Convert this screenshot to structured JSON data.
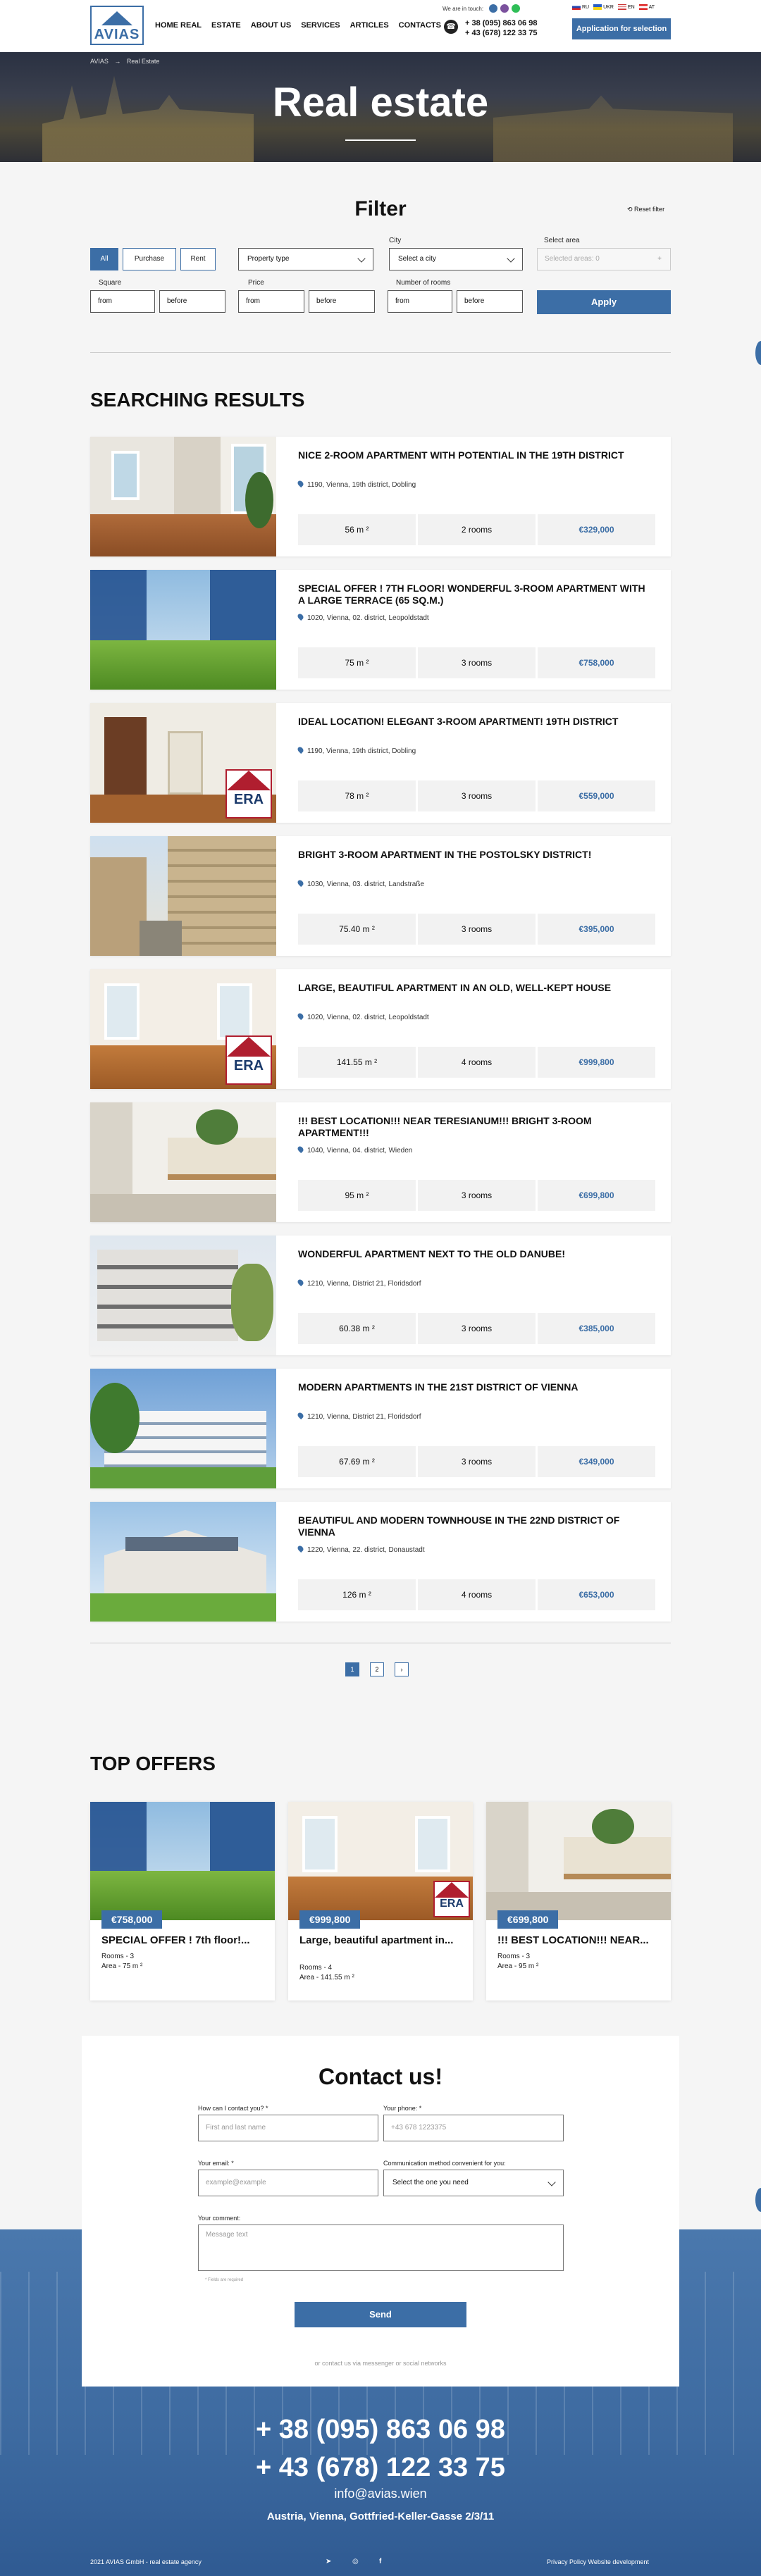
{
  "header": {
    "logo": "AVIAS",
    "nav": [
      "HOME REAL",
      "ESTATE",
      "ABOUT US",
      "SERVICES",
      "ARTICLES",
      "CONTACTS"
    ],
    "touch_label": "We are in touch:",
    "phone1": "+ 38 (095) 863 06 98",
    "phone2": "+ 43 (678) 122 33 75",
    "langs": [
      "RU",
      "UKR",
      "EN",
      "AT"
    ],
    "apply_button": "Application for selection"
  },
  "hero": {
    "breadcrumb_home": "AVIAS",
    "breadcrumb_sep": "→",
    "breadcrumb_current": "Real Estate",
    "title": "Real estate"
  },
  "filter": {
    "title": "Filter",
    "reset": "Reset filter",
    "types": [
      "All",
      "Purchase",
      "Rent"
    ],
    "property_type": "Property type",
    "city_label": "City",
    "city_placeholder": "Select a city",
    "area_label": "Select area",
    "area_placeholder": "Selected areas: 0",
    "square_label": "Square",
    "price_label": "Price",
    "rooms_label": "Number of rooms",
    "from": "from",
    "before": "before",
    "apply": "Apply"
  },
  "results": {
    "title": "SEARCHING RESULTS",
    "items": [
      {
        "title": "NICE 2-ROOM APARTMENT WITH POTENTIAL IN THE 19TH DISTRICT",
        "address": "1190, Vienna, 19th district, Dobling",
        "area": "56 m ²",
        "rooms": "2 rooms",
        "price": "€329,000"
      },
      {
        "title": "SPECIAL OFFER ! 7TH FLOOR! WONDERFUL 3-ROOM APARTMENT WITH A LARGE TERRACE (65 SQ.M.)",
        "address": "1020, Vienna, 02. district, Leopoldstadt",
        "area": "75 m ²",
        "rooms": "3 rooms",
        "price": "€758,000"
      },
      {
        "title": "IDEAL LOCATION! ELEGANT 3-ROOM APARTMENT! 19TH DISTRICT",
        "address": "1190, Vienna, 19th district, Dobling",
        "area": "78 m ²",
        "rooms": "3 rooms",
        "price": "€559,000"
      },
      {
        "title": "BRIGHT 3-ROOM APARTMENT IN THE POSTOLSKY DISTRICT!",
        "address": "1030, Vienna, 03. district, Landstraße",
        "area": "75.40 m ²",
        "rooms": "3 rooms",
        "price": "€395,000"
      },
      {
        "title": "LARGE, BEAUTIFUL APARTMENT IN AN OLD, WELL-KEPT HOUSE",
        "address": "1020, Vienna, 02. district, Leopoldstadt",
        "area": "141.55 m ²",
        "rooms": "4 rooms",
        "price": "€999,800"
      },
      {
        "title": "!!! BEST LOCATION!!! NEAR TERESIANUM!!! BRIGHT 3-ROOM APARTMENT!!!",
        "address": "1040, Vienna, 04. district, Wieden",
        "area": "95 m ²",
        "rooms": "3 rooms",
        "price": "€699,800"
      },
      {
        "title": "WONDERFUL APARTMENT NEXT TO THE OLD DANUBE!",
        "address": "1210, Vienna, District 21, Floridsdorf",
        "area": "60.38 m ²",
        "rooms": "3 rooms",
        "price": "€385,000"
      },
      {
        "title": "MODERN APARTMENTS IN THE 21ST DISTRICT OF VIENNA",
        "address": "1210, Vienna, District 21, Floridsdorf",
        "area": "67.69 m ²",
        "rooms": "3 rooms",
        "price": "€349,000"
      },
      {
        "title": "BEAUTIFUL AND MODERN TOWNHOUSE IN THE 22ND DISTRICT OF VIENNA",
        "address": "1220, Vienna, 22. district, Donaustadt",
        "area": "126 m ²",
        "rooms": "4 rooms",
        "price": "€653,000"
      }
    ],
    "pages": [
      "1",
      "2",
      "›"
    ]
  },
  "offers": {
    "title": "TOP OFFERS",
    "items": [
      {
        "price": "€758,000",
        "title": "SPECIAL OFFER ! 7th floor!...",
        "rooms": "Rooms - 3",
        "area": "Area - 75 m ²"
      },
      {
        "price": "€999,800",
        "title": "Large, beautiful apartment in...",
        "rooms": "Rooms - 4",
        "area": "Area - 141.55 m ²"
      },
      {
        "price": "€699,800",
        "title": "!!! BEST LOCATION!!! NEAR...",
        "rooms": "Rooms - 3",
        "area": "Area - 95 m ²"
      }
    ]
  },
  "contact": {
    "title": "Contact us!",
    "name_label": "How can I contact you? *",
    "name_placeholder": "First and last name",
    "phone_label": "Your phone: *",
    "phone_placeholder": "+43 678 1223375",
    "email_label": "Your email: *",
    "email_placeholder": "example@example",
    "method_label": "Communication method convenient for you:",
    "method_placeholder": "Select the one you need",
    "comment_label": "Your comment:",
    "comment_placeholder": "Message text",
    "required_note": "* Fields are required",
    "send": "Send",
    "alt": "or contact us via messenger or social networks"
  },
  "footer": {
    "phone1": "+ 38 (095) 863 06 98",
    "phone2": "+ 43 (678) 122 33 75",
    "email": "info@avias.wien",
    "address": "Austria, Vienna, Gottfried-Keller-Gasse 2/3/11",
    "copyright": "2021 AVIAS GmbH - real estate agency",
    "links": "Privacy Policy  Website development"
  },
  "colors": {
    "accent": "#3c6ea6",
    "price": "#3c6ea6"
  }
}
